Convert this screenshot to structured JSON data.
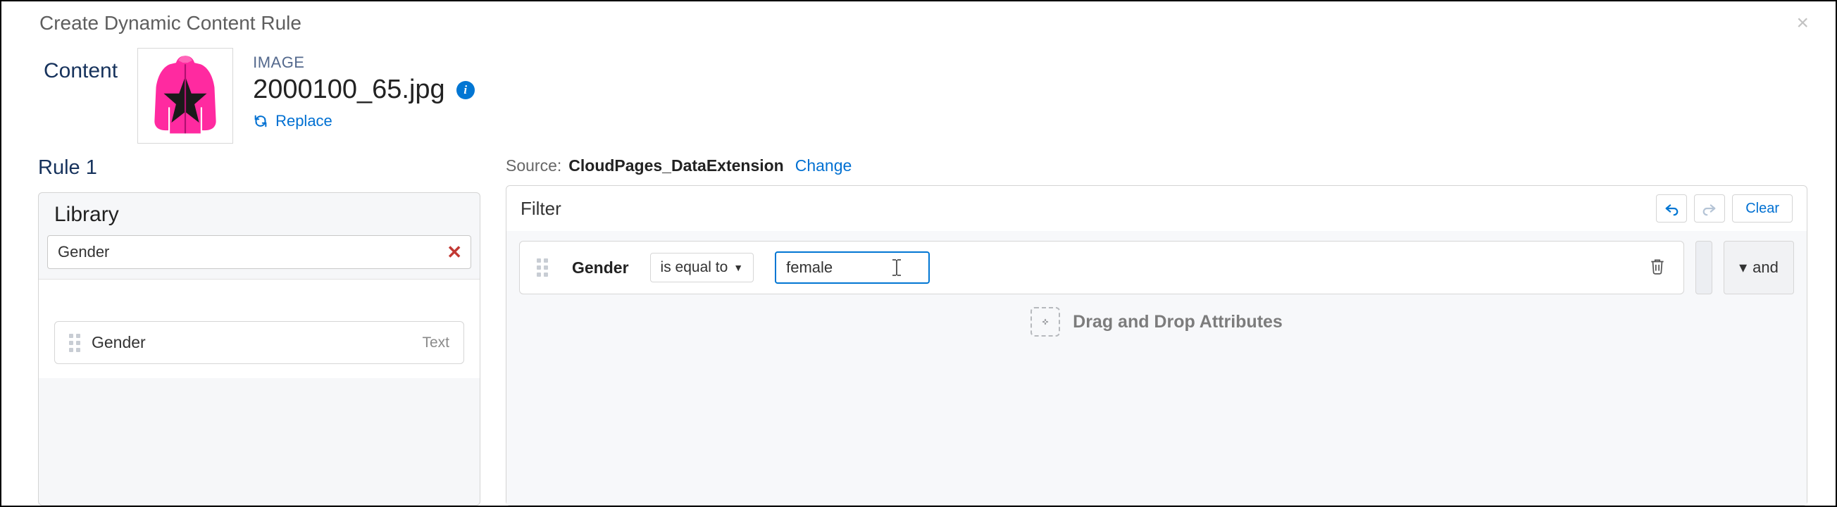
{
  "modal": {
    "title": "Create Dynamic Content Rule"
  },
  "content": {
    "heading": "Content",
    "type_label": "IMAGE",
    "file_name": "2000100_65.jpg",
    "replace": "Replace"
  },
  "rule": {
    "title": "Rule 1"
  },
  "library": {
    "heading": "Library",
    "search_value": "Gender",
    "items": [
      {
        "name": "Gender",
        "type": "Text"
      }
    ]
  },
  "source": {
    "label": "Source:",
    "name": "CloudPages_DataExtension",
    "change": "Change"
  },
  "filter": {
    "title": "Filter",
    "clear": "Clear",
    "row": {
      "field": "Gender",
      "operator": "is equal to",
      "value": "female"
    },
    "connector": "and",
    "drop_hint": "Drag and Drop Attributes"
  }
}
